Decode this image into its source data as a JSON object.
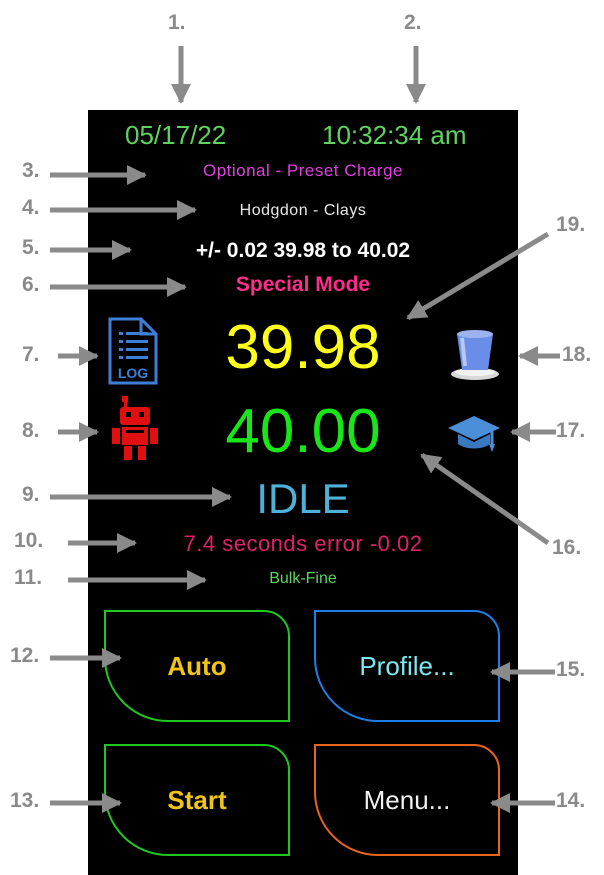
{
  "callouts": [
    "1.",
    "2.",
    "3.",
    "4.",
    "5.",
    "6.",
    "7.",
    "8.",
    "9.",
    "10.",
    "11.",
    "12.",
    "13.",
    "14.",
    "15.",
    "16.",
    "17.",
    "18.",
    "19."
  ],
  "header": {
    "date": "05/17/22",
    "time": "10:32:34 am"
  },
  "charge": {
    "preset_label": "Optional - Preset Charge",
    "powder": "Hodgdon - Clays",
    "tolerance": "+/- 0.02 39.98 to 40.02",
    "mode": "Special Mode"
  },
  "readings": {
    "target": "39.98",
    "actual": "40.00"
  },
  "status": {
    "state": "IDLE",
    "timing": "7.4 seconds  error -0.02",
    "phase": "Bulk-Fine"
  },
  "icons": {
    "log": {
      "name": "log-file-icon",
      "text": "LOG",
      "color": "#3b7fd6"
    },
    "robot": {
      "name": "robot-icon",
      "color": "#e01010"
    },
    "cup": {
      "name": "cup-icon",
      "color": "#6a8de8"
    },
    "graduation": {
      "name": "graduation-cap-icon",
      "color": "#4a8fd8"
    }
  },
  "buttons": {
    "auto": "Auto",
    "profile": "Profile...",
    "start": "Start",
    "menu": "Menu..."
  },
  "colors": {
    "background": "#000000",
    "date_time": "#5fd35f",
    "preset": "#e040e0",
    "mode": "#ff2d8a",
    "target_weight": "#ffff1a",
    "actual_weight": "#19e619",
    "status": "#4fb0d8",
    "timing": "#e0206a",
    "callout": "#8a8a8a"
  }
}
